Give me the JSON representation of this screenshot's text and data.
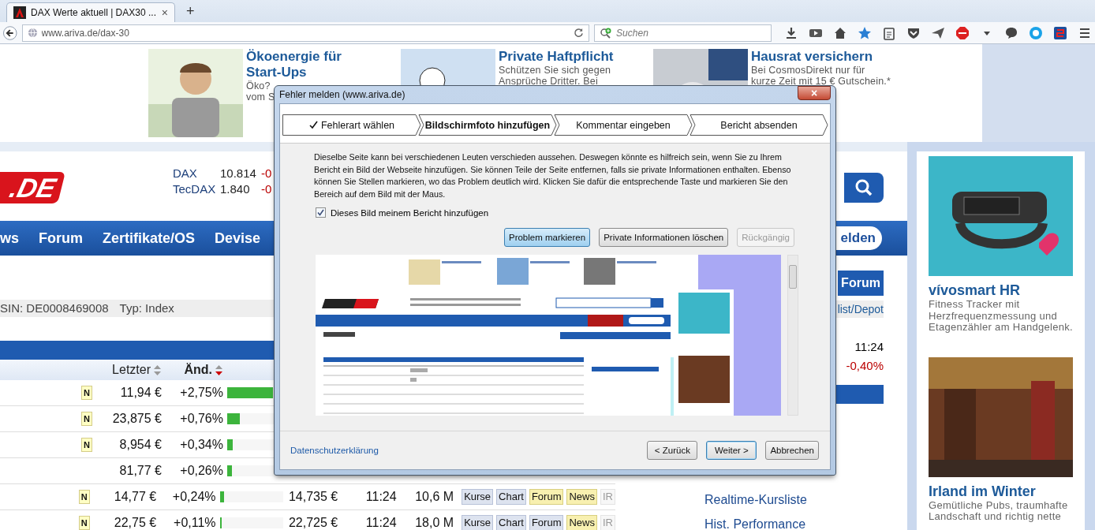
{
  "browser": {
    "tab": {
      "title": "DAX Werte aktuell | DAX30 ...",
      "close": "×"
    },
    "new_tab": "+",
    "url": "www.ariva.de/dax-30",
    "search": {
      "placeholder": "Suchen"
    }
  },
  "ads": [
    {
      "title": "Ökoenergie für Start-Ups",
      "lines": [
        "Öko?",
        "vom S"
      ]
    },
    {
      "title": "Private Haftpflicht",
      "lines": [
        "Schützen Sie sich gegen",
        "Ansprüche Dritter. Bei"
      ]
    },
    {
      "title": "Hausrat versichern",
      "lines": [
        "Bei CosmosDirekt nur für",
        "kurze Zeit mit 15 € Gutschein.*"
      ]
    }
  ],
  "header": {
    "logo": ".DE",
    "quotes": [
      {
        "name": "DAX",
        "value": "10.814",
        "change": "-0"
      },
      {
        "name": "TecDAX",
        "value": "1.840",
        "change": "-0"
      }
    ]
  },
  "nav": {
    "items": [
      "ws",
      "Forum",
      "Zertifikate/OS",
      "Devise"
    ],
    "login": "elden"
  },
  "info": {
    "isin": "SIN: DE0008469008",
    "type": "Typ: Index"
  },
  "table": {
    "columns": [
      {
        "label": "Letzter",
        "sorted": false
      },
      {
        "label": "Änd.",
        "sorted": true
      }
    ],
    "rows": [
      {
        "badge": "N",
        "last": "11,94 €",
        "change": "+2,75%",
        "level": 0.72
      },
      {
        "badge": "N",
        "last": "23,875 €",
        "change": "+0,76%",
        "level": 0.2
      },
      {
        "badge": "N",
        "last": "8,954 €",
        "change": "+0,34%",
        "level": 0.09
      },
      {
        "last": "81,77 €",
        "change": "+0,26%",
        "level": 0.08
      },
      {
        "badge": "N",
        "last": "14,77 €",
        "change": "+0,24%",
        "level": 0.07,
        "previous": "14,735 €",
        "time": "11:24",
        "volume": "10,6 M",
        "links": [
          {
            "label": "Kurse",
            "kind": "plain"
          },
          {
            "label": "Chart",
            "kind": "plain"
          },
          {
            "label": "Forum",
            "kind": "highlight"
          },
          {
            "label": "News",
            "kind": "highlight"
          },
          {
            "label": "IR",
            "kind": "disabled"
          }
        ]
      },
      {
        "badge": "N",
        "last": "22,75 €",
        "change": "+0,11%",
        "level": 0.03,
        "previous": "22,725 €",
        "time": "11:24",
        "volume": "18,0 M",
        "links": [
          {
            "label": "Kurse",
            "kind": "plain"
          },
          {
            "label": "Chart",
            "kind": "plain"
          },
          {
            "label": "Forum",
            "kind": "plain"
          },
          {
            "label": "News",
            "kind": "highlight"
          },
          {
            "label": "IR",
            "kind": "disabled"
          }
        ]
      }
    ]
  },
  "sidebar": {
    "tab": "Forum",
    "watchlist": "list/Depot",
    "time": "11:24",
    "change": "-0,40%",
    "links": [
      "Realtime-Kursliste",
      "Hist. Performance"
    ]
  },
  "side_ads": [
    {
      "title": "vívosmart HR",
      "text": "Fitness Tracker mit Herzfrequenzmessung und Etagenzähler am Handgelenk."
    },
    {
      "title": "Irland im Winter",
      "text": "Gemütliche Pubs, traumhafte Landschaft und richtig nette"
    }
  ],
  "dialog": {
    "title": "Fehler melden (www.ariva.de)",
    "close": "×",
    "steps": [
      {
        "label": "Fehlerart wählen",
        "done": true,
        "selected": false
      },
      {
        "label": "Bildschirmfoto hinzufügen",
        "done": false,
        "selected": true
      },
      {
        "label": "Kommentar eingeben",
        "done": false,
        "selected": false
      },
      {
        "label": "Bericht absenden",
        "done": false,
        "selected": false
      }
    ],
    "description": "Dieselbe Seite kann bei verschiedenen Leuten verschieden aussehen. Deswegen könnte es hilfreich sein, wenn Sie zu Ihrem Bericht ein Bild der Webseite hinzufügen. Sie können Teile der Seite entfernen, falls sie private Informationen enthalten. Ebenso können Sie Stellen markieren, wo das Problem deutlich wird. Klicken Sie dafür die entsprechende Taste und markieren Sie den Bereich auf dem Bild mit der Maus.",
    "checkbox": {
      "label": "Dieses Bild meinem Bericht hinzufügen",
      "checked": true
    },
    "tools": [
      {
        "label": "Problem markieren",
        "pressed": true,
        "disabled": false
      },
      {
        "label": "Private Informationen löschen",
        "pressed": false,
        "disabled": false
      },
      {
        "label": "Rückgängig",
        "pressed": false,
        "disabled": true
      }
    ],
    "privacy_link": "Datenschutzerklärung",
    "buttons": [
      {
        "label": "< Zurück",
        "default": false
      },
      {
        "label": "Weiter >",
        "default": true
      },
      {
        "label": "Abbrechen",
        "default": false
      }
    ]
  }
}
